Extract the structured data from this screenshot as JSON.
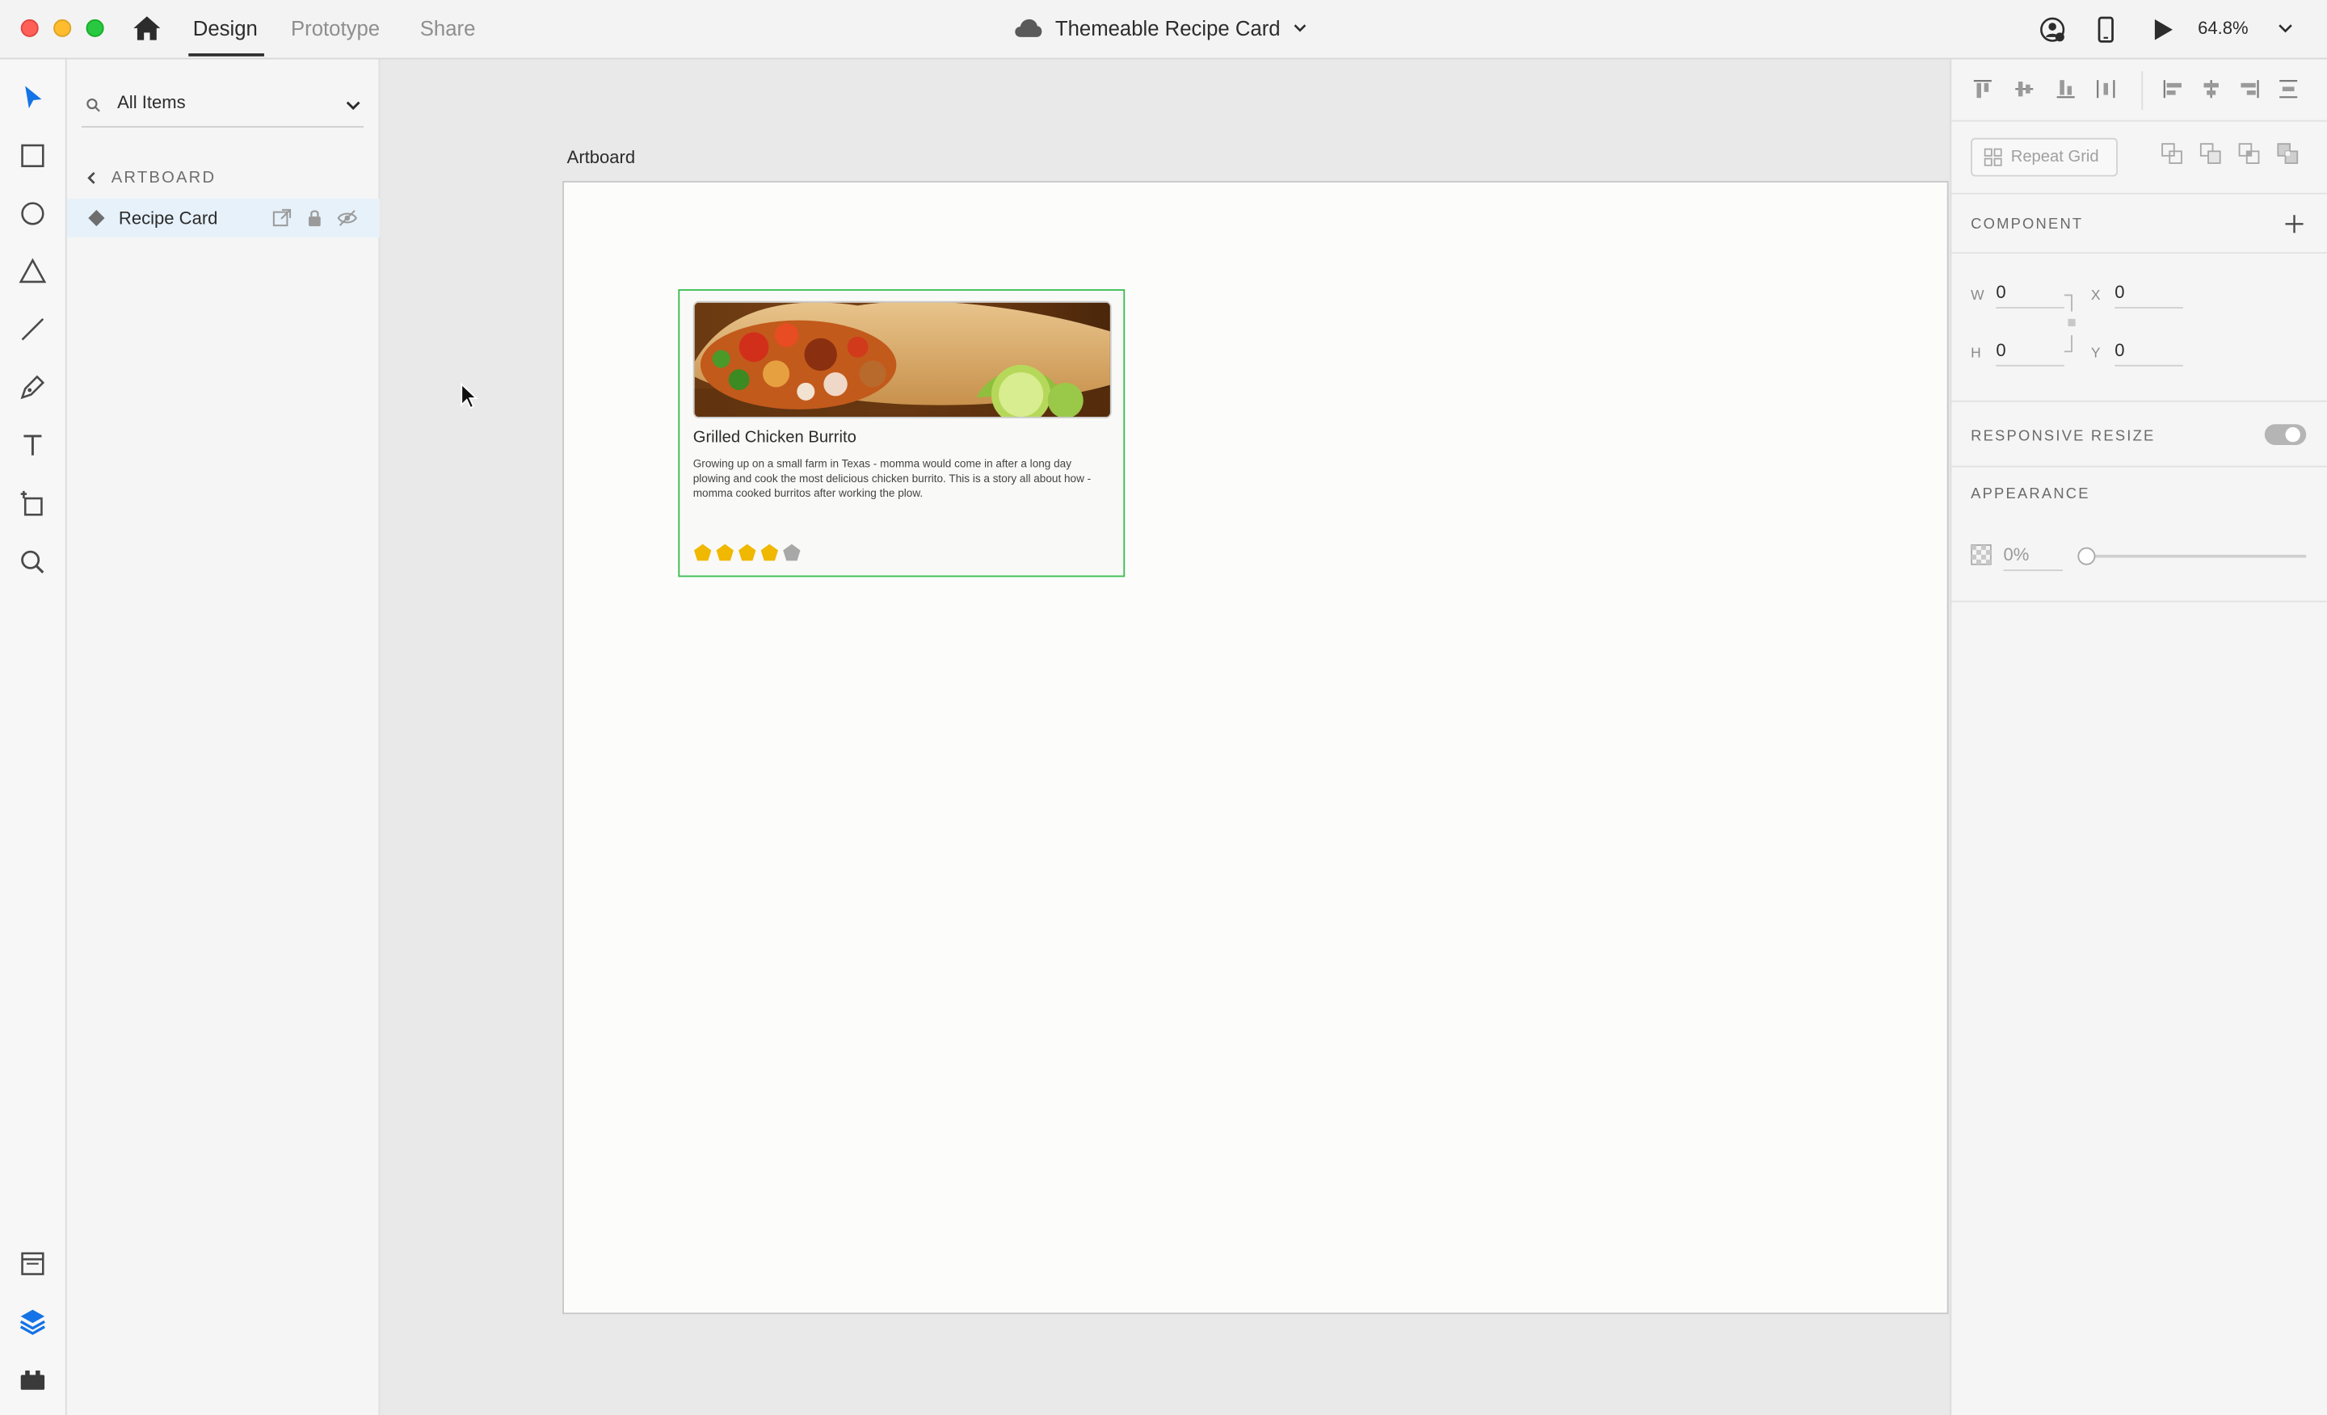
{
  "titlebar": {
    "tabs": [
      {
        "label": "Design",
        "active": true
      },
      {
        "label": "Prototype",
        "active": false
      },
      {
        "label": "Share",
        "active": false
      }
    ],
    "document_title": "Themeable Recipe Card",
    "zoom": "64.8%"
  },
  "toolbar": {
    "tools": [
      "select-tool",
      "rectangle-tool",
      "ellipse-tool",
      "polygon-tool",
      "line-tool",
      "pen-tool",
      "text-tool",
      "artboard-tool",
      "zoom-tool"
    ],
    "bottom": [
      "assets-icon",
      "layers-icon",
      "plugins-icon"
    ]
  },
  "layers": {
    "search_value": "All Items",
    "breadcrumb": "ARTBOARD",
    "items": [
      {
        "label": "Recipe Card",
        "type": "component"
      }
    ]
  },
  "canvas": {
    "artboard_label": "Artboard",
    "card": {
      "title": "Grilled Chicken Burrito",
      "description": "Growing up on a small farm in Texas - momma would come in after a long day plowing and cook the most delicious chicken burrito. This is a story all about how - momma cooked burritos after working the plow.",
      "rating": 4,
      "rating_max": 5,
      "star_color": "#f0b800",
      "star_empty_color": "#a8a8a8"
    }
  },
  "properties": {
    "repeat_grid_label": "Repeat Grid",
    "component_heading": "COMPONENT",
    "w_label": "W",
    "w_value": "0",
    "h_label": "H",
    "h_value": "0",
    "x_label": "X",
    "x_value": "0",
    "y_label": "Y",
    "y_value": "0",
    "responsive_heading": "RESPONSIVE RESIZE",
    "responsive_enabled": true,
    "appearance_heading": "APPEARANCE",
    "opacity_value": "0%"
  },
  "colors": {
    "selection": "#3bbd50",
    "accent": "#1473e6"
  }
}
